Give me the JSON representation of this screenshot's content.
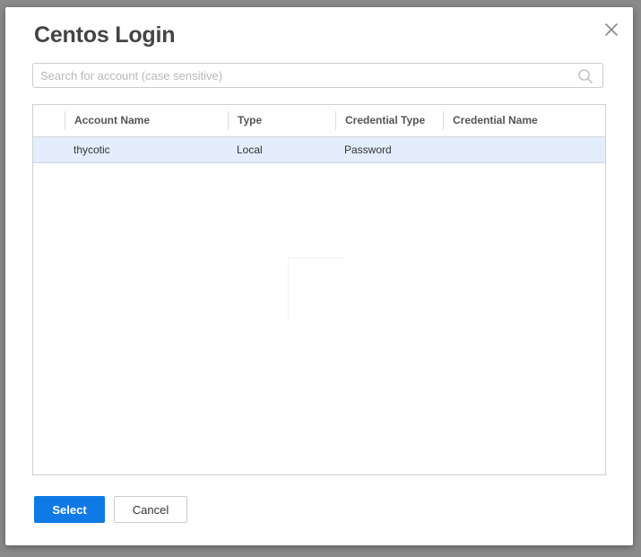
{
  "dialog": {
    "title": "Centos Login",
    "close_icon": "close-icon"
  },
  "search": {
    "placeholder": "Search for account (case sensitive)",
    "value": "",
    "icon": "search-icon"
  },
  "grid": {
    "columns": [
      {
        "label": "Account Name"
      },
      {
        "label": "Type"
      },
      {
        "label": "Credential Type"
      },
      {
        "label": "Credential Name"
      }
    ],
    "rows": [
      {
        "account_name": "thycotic",
        "type": "Local",
        "credential_type": "Password",
        "credential_name": "",
        "selected": true
      }
    ]
  },
  "actions": {
    "select_label": "Select",
    "cancel_label": "Cancel"
  },
  "colors": {
    "primary_button": "#0f7ae5",
    "selected_row": "#e3edfb",
    "title_text": "#444444"
  }
}
